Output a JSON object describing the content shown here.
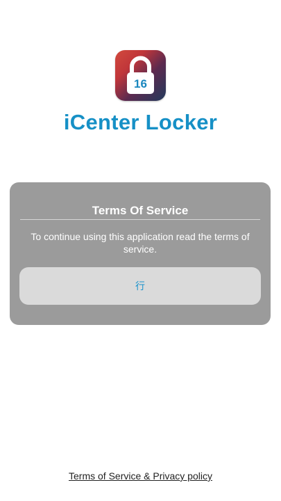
{
  "app": {
    "title": "iCenter Locker",
    "icon_name": "padlock-16-icon",
    "icon_badge": "16",
    "title_color": "#1690c6"
  },
  "dialog": {
    "title": "Terms Of Service",
    "message": "To continue using this application read the terms of service.",
    "button_label": "行",
    "button_text_color": "#1a93cc",
    "background_color": "#9b9b9b"
  },
  "footer": {
    "link_label": "Terms of Service & Privacy policy"
  }
}
